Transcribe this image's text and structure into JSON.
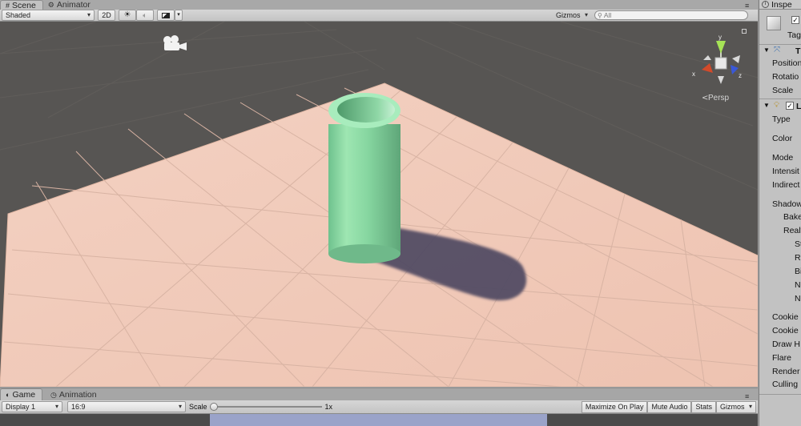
{
  "scene_tabs": [
    {
      "label": "Scene",
      "icon": "grid-icon",
      "active": true
    },
    {
      "label": "Animator",
      "icon": "animator-icon",
      "active": false
    }
  ],
  "scene_toolbar": {
    "draw_mode": "Shaded",
    "mode_2d": "2D",
    "gizmos": "Gizmos",
    "search_placeholder": "All"
  },
  "scene_view": {
    "persp_label": "Persp",
    "axis_x": "x",
    "axis_y": "y",
    "axis_z": "z"
  },
  "inspector": {
    "tab_label": "Inspe",
    "tag_label": "Tag",
    "transform_header": "T",
    "transform_rows": [
      "Position",
      "Rotatio",
      "Scale"
    ],
    "light_header": "L",
    "light_rows": [
      "Type",
      "Color",
      "Mode",
      "Intensit",
      "Indirect",
      "Shadow"
    ],
    "shadow_sub": [
      "Bake",
      "Realt"
    ],
    "shadow_sub2": [
      "St",
      "Re",
      "Bi",
      "N",
      "N"
    ],
    "lower_rows": [
      "Cookie",
      "Cookie",
      "Draw H",
      "Flare",
      "Render",
      "Culling"
    ]
  },
  "game_tabs": [
    {
      "label": "Game",
      "icon": "game-icon",
      "active": true
    },
    {
      "label": "Animation",
      "icon": "animation-icon",
      "active": false
    }
  ],
  "game_toolbar": {
    "display": "Display 1",
    "aspect": "16:9",
    "scale_label": "Scale",
    "scale_value": "1x",
    "scale_fraction": 0.0,
    "maximize": "Maximize On Play",
    "mute": "Mute Audio",
    "stats": "Stats",
    "gizmos": "Gizmos"
  },
  "colors": {
    "sky": "#575553",
    "ground": "#f1c9b7",
    "cylinder": "#86d6a0",
    "shadow": "#4f4862",
    "game_view": "#9aa3c9"
  }
}
